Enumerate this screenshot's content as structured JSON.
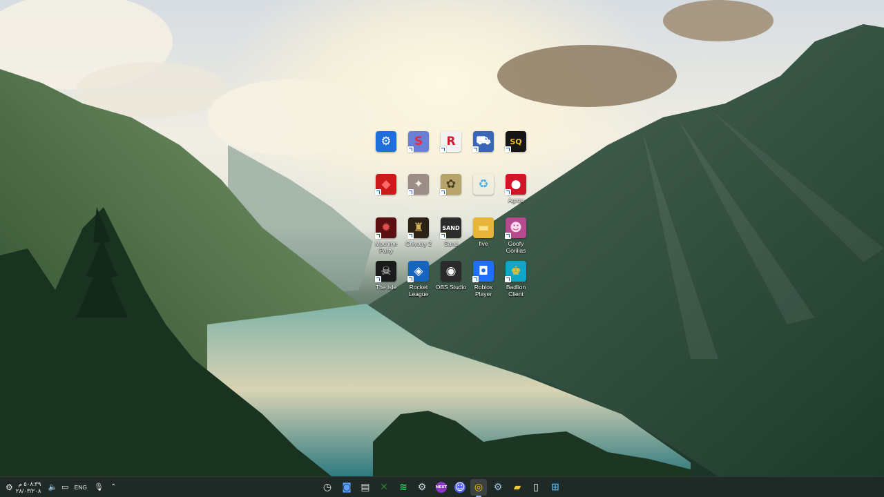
{
  "desktop": {
    "icons": [
      {
        "name": "icon-app-blue-gear",
        "label": "",
        "symbol": "⚙",
        "bg": "#1e6fd9",
        "fg": "#ffffff",
        "shortcut": false
      },
      {
        "name": "icon-app-red-s",
        "label": "",
        "symbol": "S",
        "bg": "#6a7fd6",
        "fg": "#e8283c",
        "shortcut": true
      },
      {
        "name": "icon-app-red-r",
        "label": "",
        "symbol": "R",
        "bg": "#f2f2f2",
        "fg": "#d11a2a",
        "shortcut": true
      },
      {
        "name": "icon-app-blue-truck",
        "label": "",
        "symbol": "⛟",
        "bg": "#3b66b8",
        "fg": "#ffffff",
        "shortcut": true
      },
      {
        "name": "icon-app-sq",
        "label": "",
        "symbol": "SQ",
        "bg": "#161616",
        "fg": "#f2c21b",
        "shortcut": true
      },
      {
        "name": "icon-app-red-car",
        "label": "",
        "symbol": "◆",
        "bg": "#cc1a1a",
        "fg": "#ff6b6b",
        "shortcut": true
      },
      {
        "name": "icon-app-stone",
        "label": "",
        "symbol": "✦",
        "bg": "#9a8e86",
        "fg": "#f2ede6",
        "shortcut": true
      },
      {
        "name": "icon-app-olive",
        "label": "",
        "symbol": "✿",
        "bg": "#b7a46a",
        "fg": "#4b3f24",
        "shortcut": true
      },
      {
        "name": "icon-recycle-bin",
        "label": "",
        "symbol": "♻",
        "bg": "rgba(255,255,255,0)",
        "fg": "#4db3e8",
        "shortcut": false
      },
      {
        "name": "icon-agrou",
        "label": "Agrou",
        "symbol": "●",
        "bg": "#d01626",
        "fg": "#ffffff",
        "shortcut": true
      },
      {
        "name": "icon-machine-party",
        "label": "Machine\nParty",
        "symbol": "✹",
        "bg": "#5a1010",
        "fg": "#e05050",
        "shortcut": true
      },
      {
        "name": "icon-chivalry",
        "label": "Chivalry 2",
        "symbol": "♜",
        "bg": "#2b2416",
        "fg": "#d7b35a",
        "shortcut": true
      },
      {
        "name": "icon-sand",
        "label": "Sand",
        "symbol": "SAND",
        "bg": "#2c2c2c",
        "fg": "#ffffff",
        "shortcut": true
      },
      {
        "name": "icon-folder-five",
        "label": "five",
        "symbol": "▬",
        "bg": "#e8b43a",
        "fg": "#fbe08a",
        "shortcut": false
      },
      {
        "name": "icon-goofy-gorillas",
        "label": "Goofy\nGorillas",
        "symbol": "☻",
        "bg": "#b54a8f",
        "fg": "#ffd9f0",
        "shortcut": true
      },
      {
        "name": "icon-the-isle",
        "label": "The Isle",
        "symbol": "☠",
        "bg": "#1a1a1a",
        "fg": "#e6e6e6",
        "shortcut": true
      },
      {
        "name": "icon-rocket-league",
        "label": "Rocket\nLeague",
        "symbol": "◈",
        "bg": "#1565c0",
        "fg": "#ffffff",
        "shortcut": true
      },
      {
        "name": "icon-obs-studio",
        "label": "OBS Studio",
        "symbol": "◉",
        "bg": "#2a2a2a",
        "fg": "#ffffff",
        "shortcut": false
      },
      {
        "name": "icon-roblox-player",
        "label": "Roblox\nPlayer",
        "symbol": "◘",
        "bg": "#1e6fff",
        "fg": "#ffffff",
        "shortcut": true
      },
      {
        "name": "icon-badlion-client",
        "label": "Badlion\nClient",
        "symbol": "♚",
        "bg": "#0fa7c8",
        "fg": "#f4c430",
        "shortcut": true
      }
    ]
  },
  "tray": {
    "time": "٥٠٨:٣٩ م",
    "date": "٢٨/٠٣/٢٠٨",
    "language": "ENG",
    "icons": [
      "gear-icon",
      "speaker-icon",
      "display-icon",
      "microphone-icon",
      "chevron-up-icon"
    ]
  },
  "taskbar": {
    "apps": [
      {
        "name": "taskbar-app-clock",
        "symbol": "◷",
        "color": "#e0e0e0",
        "bg": "transparent",
        "active": false
      },
      {
        "name": "taskbar-app-camera",
        "symbol": "◙",
        "color": "#5aa0ff",
        "bg": "transparent",
        "active": false
      },
      {
        "name": "taskbar-app-terminal",
        "symbol": "▤",
        "color": "#d8d8d8",
        "bg": "transparent",
        "active": false
      },
      {
        "name": "taskbar-app-xbox",
        "symbol": "✕",
        "color": "#2e7d32",
        "bg": "transparent",
        "active": false
      },
      {
        "name": "taskbar-app-spotify",
        "symbol": "≋",
        "color": "#1ed760",
        "bg": "transparent",
        "active": false
      },
      {
        "name": "taskbar-app-steam",
        "symbol": "⚙",
        "color": "#cfd8dc",
        "bg": "transparent",
        "active": false
      },
      {
        "name": "taskbar-app-next",
        "symbol": "NEXT",
        "color": "#ffffff",
        "bg": "#8a35c8",
        "active": false
      },
      {
        "name": "taskbar-app-discord",
        "symbol": "☺",
        "color": "#ffffff",
        "bg": "#5865f2",
        "active": false
      },
      {
        "name": "taskbar-app-chrome",
        "symbol": "◎",
        "color": "#fbbc05",
        "bg": "transparent",
        "active": true
      },
      {
        "name": "taskbar-app-steam-2",
        "symbol": "⚙",
        "color": "#9ec4e8",
        "bg": "transparent",
        "active": false
      },
      {
        "name": "taskbar-app-file-explorer",
        "symbol": "▰",
        "color": "#f4c542",
        "bg": "transparent",
        "active": false
      },
      {
        "name": "taskbar-app-notepad",
        "symbol": "▯",
        "color": "#f5f5f5",
        "bg": "transparent",
        "active": false
      },
      {
        "name": "taskbar-app-start",
        "symbol": "⊞",
        "color": "#3fb5ff",
        "bg": "transparent",
        "active": false
      }
    ]
  }
}
